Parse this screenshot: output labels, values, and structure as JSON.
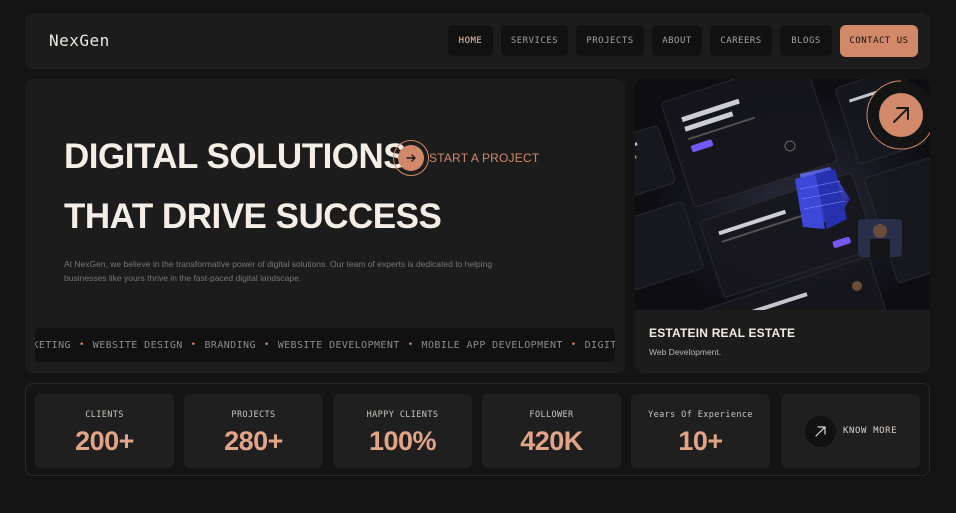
{
  "nav": {
    "brand": "NexGen",
    "items": [
      "HOME",
      "SERVICES",
      "PROJECTS",
      "ABOUT",
      "CAREERS",
      "BLOGS"
    ],
    "contact_label": "CONTACT US",
    "active_item": "HOME"
  },
  "hero": {
    "line1": "DIGITAL SOLUTIONS",
    "line2": "THAT DRIVE SUCCESS",
    "cta_label": "START A PROJECT",
    "cta_icon": "arrow-right-icon",
    "description": "At NexGen, we believe in the transformative power of digital solutions. Our team of experts is dedicated to helping businesses like yours thrive in the fast-paced digital landscape.",
    "ticker": [
      "RKETING",
      "WEBSITE DESIGN",
      "BRANDING",
      "WEBSITE DEVELOPMENT",
      "MOBILE APP DEVELOPMENT",
      "DIGITAL"
    ]
  },
  "project": {
    "title": "ESTATEIN REAL ESTATE",
    "subtitle": "Web Development.",
    "badge_icon": "arrow-up-right-icon"
  },
  "stats": [
    {
      "label": "CLIENTS",
      "value": "200+"
    },
    {
      "label": "PROJECTS",
      "value": "280+"
    },
    {
      "label": "HAPPY CLIENTS",
      "value": "100%"
    },
    {
      "label": "FOLLOWER",
      "value": "420K"
    },
    {
      "label": "Years Of Experience",
      "value": "10+"
    }
  ],
  "know_more": {
    "label": "KNOW MORE",
    "icon": "arrow-up-right-icon"
  },
  "colors": {
    "accent": "#d2896a",
    "background": "#141414",
    "panel": "#1c1c1c",
    "stat_value": "#e1a488"
  }
}
